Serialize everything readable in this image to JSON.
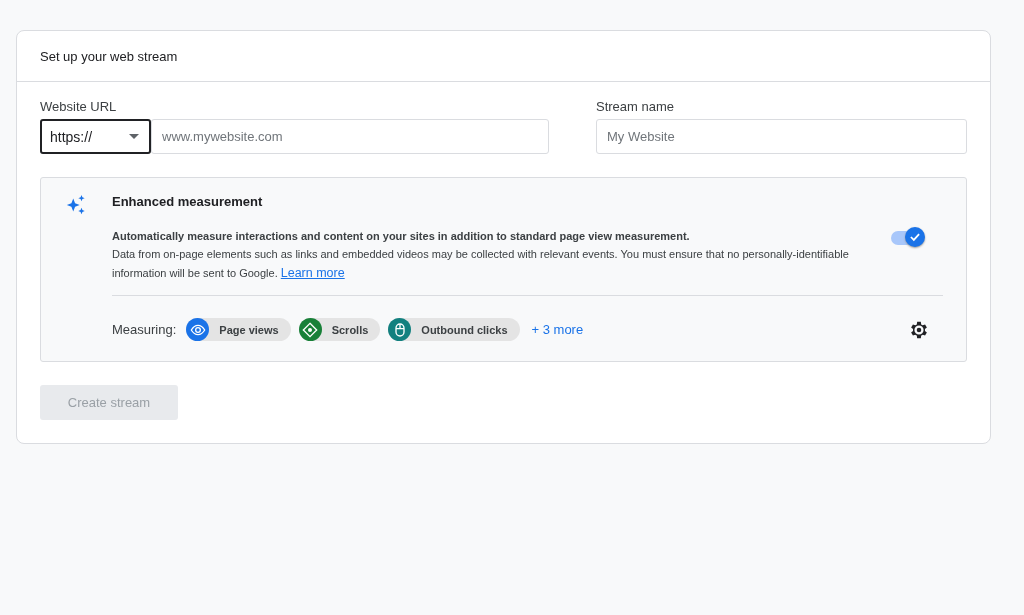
{
  "card": {
    "title": "Set up your web stream"
  },
  "website_url": {
    "label": "Website URL",
    "protocol": "https://",
    "placeholder": "www.mywebsite.com"
  },
  "stream_name": {
    "label": "Stream name",
    "placeholder": "My Website"
  },
  "enhanced_measurement": {
    "title": "Enhanced measurement",
    "summary": "Automatically measure interactions and content on your sites in addition to standard page view measurement.",
    "description": "Data from on-page elements such as links and embedded videos may be collected with relevant events. You must ensure that no personally-identifiable information will be sent to Google.",
    "link": "Learn more",
    "on": true,
    "measuring_label": "Measuring:",
    "chips": [
      {
        "kind": "eye",
        "label": "Page views",
        "color": "#1a73e8"
      },
      {
        "kind": "scroll",
        "label": "Scrolls",
        "color": "#188038"
      },
      {
        "kind": "mouse",
        "label": "Outbound clicks",
        "color": "#12807f"
      }
    ],
    "more": "+ 3 more"
  },
  "create_button": {
    "label": "Create stream",
    "disabled": true
  }
}
